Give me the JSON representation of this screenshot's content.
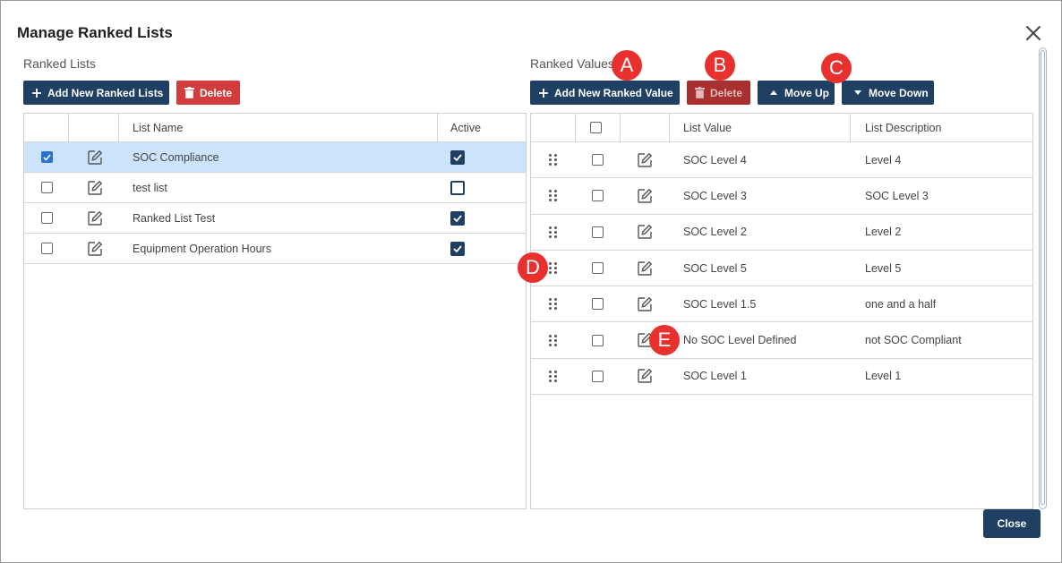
{
  "dialog": {
    "title": "Manage Ranked Lists",
    "close_button_label": "Close"
  },
  "left": {
    "section_label": "Ranked Lists",
    "add_button": "Add New Ranked Lists",
    "delete_button": "Delete",
    "columns": [
      "",
      "",
      "List Name",
      "Active"
    ],
    "rows": [
      {
        "name": "SOC Compliance",
        "selected": true,
        "active": true
      },
      {
        "name": "test list",
        "selected": false,
        "active": false
      },
      {
        "name": "Ranked List Test",
        "selected": false,
        "active": true
      },
      {
        "name": "Equipment Operation Hours",
        "selected": false,
        "active": true
      }
    ]
  },
  "right": {
    "section_label": "Ranked Values",
    "add_button": "Add New Ranked Value",
    "delete_button": "Delete",
    "move_up_button": "Move Up",
    "move_down_button": "Move Down",
    "columns": [
      "",
      "",
      "",
      "List Value",
      "List Description"
    ],
    "rows": [
      {
        "value": "SOC Level 4",
        "description": "Level 4"
      },
      {
        "value": "SOC Level 3",
        "description": "SOC Level 3"
      },
      {
        "value": "SOC Level 2",
        "description": "Level 2"
      },
      {
        "value": "SOC Level 5",
        "description": "Level 5"
      },
      {
        "value": "SOC Level 1.5",
        "description": "one and a half"
      },
      {
        "value": "No SOC Level Defined",
        "description": "not SOC Compliant"
      },
      {
        "value": "SOC Level 1",
        "description": "Level 1"
      }
    ]
  },
  "callouts": {
    "a": "A",
    "b": "B",
    "c": "C",
    "d": "D",
    "e": "E"
  },
  "colors": {
    "primary": "#1f3f63",
    "danger": "#d23c3c",
    "selected_row": "#cce4fb",
    "callout": "#e8302f"
  },
  "icons": {
    "close": "close-icon",
    "add": "plus-icon",
    "delete": "trash-icon",
    "edit": "edit-icon",
    "drag": "drag-handle-icon",
    "move_up": "caret-up-icon",
    "move_down": "caret-down-icon"
  }
}
